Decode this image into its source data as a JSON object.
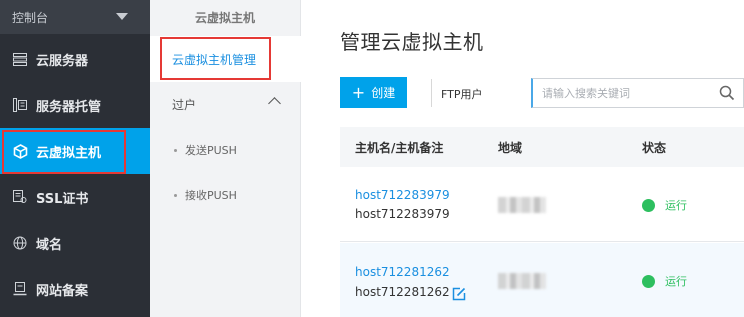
{
  "sidebar": {
    "console_label": "控制台",
    "items": [
      {
        "label": "云服务器",
        "icon": "server-list-icon"
      },
      {
        "label": "服务器托管",
        "icon": "hosting-icon"
      },
      {
        "label": "云虚拟主机",
        "icon": "cube-icon",
        "active": true
      },
      {
        "label": "SSL证书",
        "icon": "certificate-icon"
      },
      {
        "label": "域名",
        "icon": "globe-icon"
      },
      {
        "label": "网站备案",
        "icon": "record-icon"
      }
    ]
  },
  "subnav": {
    "title": "云虚拟主机",
    "active_item": "云虚拟主机管理",
    "group_label": "过户",
    "sub_items": [
      "发送PUSH",
      "接收PUSH"
    ]
  },
  "main": {
    "title": "管理云虚拟主机",
    "create_label": "创建",
    "ftp_label": "FTP用户",
    "search_placeholder": "请输入搜索关键词",
    "columns": [
      "主机名/主机备注",
      "地域",
      "状态"
    ],
    "rows": [
      {
        "host_link": "host712283979",
        "host_name": "host712283979",
        "status": "运行"
      },
      {
        "host_link": "host712281262",
        "host_name": "host712281262",
        "status": "运行"
      }
    ]
  },
  "colors": {
    "accent": "#00a2ea",
    "sidebar_bg": "#2b2f36",
    "status_running": "#2dbf5f",
    "highlight_box": "#e53935"
  }
}
